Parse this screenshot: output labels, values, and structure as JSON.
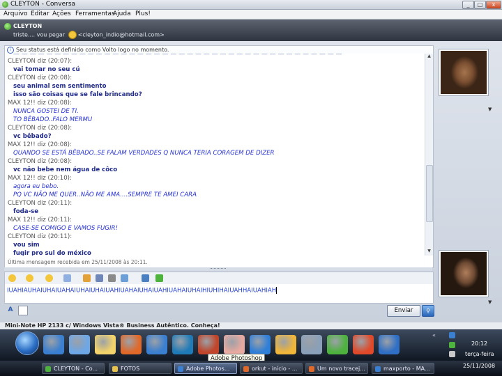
{
  "window": {
    "title": "CLEYTON - Conversa",
    "buttons": [
      "_",
      "□",
      "x"
    ]
  },
  "menu": [
    "Arquivo",
    "Editar",
    "Ações",
    "Ferramentas",
    "Ajuda",
    "Plus!"
  ],
  "contact": {
    "name": "CLEYTON",
    "message_before": "triste.... vou pegar",
    "email": "<cleyton_indio@hotmail.com>"
  },
  "status_notice": "Seu status está definido como Volto logo no momento.",
  "conversation": [
    {
      "kind": "hdr",
      "text": "CLEYTON diz (20:07):"
    },
    {
      "kind": "c",
      "text": "vai tomar no seu cú"
    },
    {
      "kind": "hdr",
      "text": "CLEYTON diz (20:08):"
    },
    {
      "kind": "c",
      "text": "seu animal sem sentimento"
    },
    {
      "kind": "c",
      "text": "isso são coisas que se fale brincando?"
    },
    {
      "kind": "hdr",
      "text": "MAX 12!! diz (20:08):"
    },
    {
      "kind": "m",
      "text": "NUNCA GOSTEI DE TI."
    },
    {
      "kind": "m",
      "text": "TO BÊBADO..FALO MERMU"
    },
    {
      "kind": "hdr",
      "text": "CLEYTON diz (20:08):"
    },
    {
      "kind": "c",
      "text": "vc bêbado?"
    },
    {
      "kind": "hdr",
      "text": "MAX 12!! diz (20:08):"
    },
    {
      "kind": "m",
      "text": "QUANDO SE ESTÁ BÊBADO..SE FALAM VERDADES Q NUNCA TERIA CORAGEM DE DIZER"
    },
    {
      "kind": "hdr",
      "text": "CLEYTON diz (20:08):"
    },
    {
      "kind": "c",
      "text": "vc não bebe nem água de côco"
    },
    {
      "kind": "hdr",
      "text": "MAX 12!! diz (20:10):"
    },
    {
      "kind": "m",
      "text": "agora eu bebo."
    },
    {
      "kind": "m",
      "text": "PQ VC NÃO ME QUER..NÃO ME AMA....SEMPRE TE AMEI CARA"
    },
    {
      "kind": "hdr",
      "text": "CLEYTON diz (20:11):"
    },
    {
      "kind": "c",
      "text": "foda-se"
    },
    {
      "kind": "hdr",
      "text": "MAX 12!! diz (20:11):"
    },
    {
      "kind": "m",
      "text": "CASE-SE COMIGO E VAMOS FUGIR!"
    },
    {
      "kind": "hdr",
      "text": "CLEYTON diz (20:11):"
    },
    {
      "kind": "c",
      "text": "vou sim"
    },
    {
      "kind": "c",
      "text": "fugir pro sul do méxico"
    }
  ],
  "last_message": "Última mensagem recebida em 25/11/2008 às 20:11.",
  "input_text": "IUAHIAUHAIUHAIUAHAIUHAIUHAIUAHIUAHAIUHAIUAHIUAHAIUHAIHIUHIHAIUAHHAIUAHIAH",
  "send_label": "Enviar",
  "ad_text": "Mini-Note HP 2133 c/ Windows Vista® Business Autêntico. Conheça!",
  "tooltip": "Adobe Photoshop",
  "taskbar": [
    {
      "label": "CLEYTON - Co...",
      "active": false,
      "icon_color": "#4db33d"
    },
    {
      "label": "FOTOS",
      "active": false,
      "icon_color": "#e8c24a"
    },
    {
      "label": "Adobe Photos...",
      "active": true,
      "icon_color": "#3a7fd0"
    },
    {
      "label": "orkut - início - ...",
      "active": false,
      "icon_color": "#e0692a"
    },
    {
      "label": "Um novo tracej...",
      "active": false,
      "icon_color": "#e0692a"
    },
    {
      "label": "maxporto - MA...",
      "active": false,
      "icon_color": "#3a7fd0"
    }
  ],
  "clock": {
    "time": "20:12",
    "day": "terça-feira",
    "date": "25/11/2008"
  },
  "icons": {
    "dock": [
      "ie-icon",
      "network-icon",
      "search-icon",
      "firefox-icon",
      "ie-icon",
      "feather-icon",
      "photoshop-icon",
      "hand-icon",
      "media-player-icon",
      "winamp-icon",
      "camera-icon",
      "msn-icon",
      "office-icon",
      "app-icon"
    ]
  }
}
